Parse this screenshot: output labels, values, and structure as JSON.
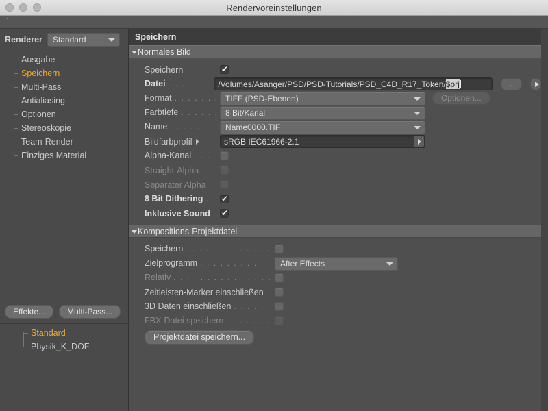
{
  "window": {
    "title": "Rendervoreinstellungen",
    "traffic_lights": [
      "close",
      "minimize",
      "zoom"
    ]
  },
  "sidebar": {
    "renderer_label": "Renderer",
    "renderer_value": "Standard",
    "items": [
      {
        "label": "Ausgabe"
      },
      {
        "label": "Speichern"
      },
      {
        "label": "Multi-Pass"
      },
      {
        "label": "Antialiasing"
      },
      {
        "label": "Optionen"
      },
      {
        "label": "Stereoskopie"
      },
      {
        "label": "Team-Render"
      },
      {
        "label": "Einziges Material"
      }
    ],
    "effects_button": "Effekte...",
    "multipass_button": "Multi-Pass...",
    "presets": [
      {
        "label": "Standard"
      },
      {
        "label": "Physik_K_DOF"
      }
    ]
  },
  "main": {
    "panel_title": "Speichern",
    "group_normal": {
      "title": "Normales Bild",
      "save_label": "Speichern",
      "file_label": "Datei",
      "file_path_prefix": "/Volumes/Asanger/PSD/PSD-Tutorials/PSD_C4D_R17_Token/",
      "file_path_selected": "$prj",
      "browse_button": "...",
      "format_label": "Format",
      "format_value": "TIFF (PSD-Ebenen)",
      "options_button": "Optionen...",
      "depth_label": "Farbtiefe",
      "depth_value": "8 Bit/Kanal",
      "name_label": "Name",
      "name_value": "Name0000.TIF",
      "profile_label": "Bildfarbprofil",
      "profile_value": "sRGB IEC61966-2.1",
      "alpha_label": "Alpha-Kanal",
      "straight_alpha_label": "Straight-Alpha",
      "separate_alpha_label": "Separater Alpha",
      "dithering_label": "8 Bit Dithering",
      "sound_label": "Inklusive Sound"
    },
    "group_comp": {
      "title": "Kompositions-Projektdatei",
      "save_label": "Speichern",
      "target_label": "Zielprogramm",
      "target_value": "After Effects",
      "relative_label": "Relativ",
      "markers_label": "Zeitleisten-Marker einschließen",
      "data3d_label": "3D Daten einschließen",
      "fbx_label": "FBX-Datei speichern",
      "save_project_button": "Projektdatei speichern..."
    }
  },
  "colors": {
    "accent": "#f0a82a",
    "panel_bg": "#4f4f4f",
    "sidebar_bg": "#4a4a4a",
    "selection": "#d2d2d2"
  }
}
